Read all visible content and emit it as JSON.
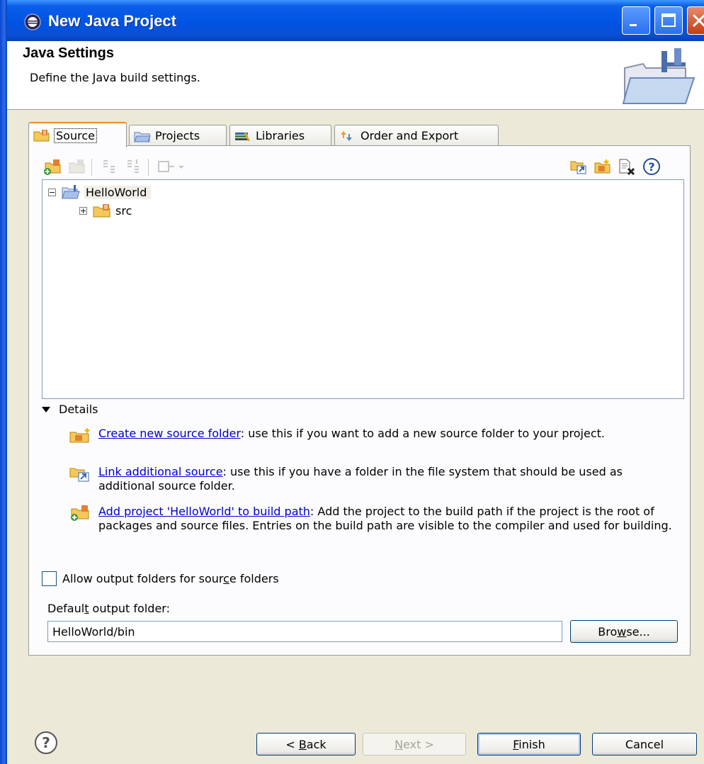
{
  "window": {
    "title": "New Java Project"
  },
  "header": {
    "title": "Java Settings",
    "description": "Define the Java build settings."
  },
  "tabs": [
    {
      "label": "Source",
      "icon": "source-folder-icon",
      "active": true
    },
    {
      "label": "Projects",
      "icon": "projects-icon",
      "active": false
    },
    {
      "label": "Libraries",
      "icon": "libraries-icon",
      "active": false
    },
    {
      "label": "Order and Export",
      "icon": "order-export-icon",
      "active": false
    }
  ],
  "toolbar": {
    "left_icons": [
      "add-folder-icon",
      "remove-folder-icon",
      "exclusion-icon",
      "inclusion-icon",
      "configure-icon"
    ],
    "right_icons": [
      "link-source-icon",
      "new-source-folder-icon",
      "clear-icon",
      "help-icon"
    ],
    "help_glyph": "?"
  },
  "tree": {
    "project": {
      "label": "HelloWorld",
      "expanded": true
    },
    "folder": {
      "label": "src",
      "expanded": false
    }
  },
  "details": {
    "toggle_label": "Details",
    "items": [
      {
        "link": "Create new source folder",
        "text": ": use this if you want to add a new source folder to your project."
      },
      {
        "link": "Link additional source",
        "text": ": use this if you have a folder in the file system that should be used as additional source folder."
      },
      {
        "link": "Add project 'HelloWorld' to build path",
        "text": ": Add the project to the build path if the project is the root of packages and source files. Entries on the build path are visible to the compiler and used for building."
      }
    ]
  },
  "options": {
    "allow_output_label_a": "Allow output folders for sour",
    "allow_output_label_u": "c",
    "allow_output_label_b": "e folders",
    "allow_output_checked": false
  },
  "output": {
    "label_a": "Defaul",
    "label_u": "t",
    "label_b": " output folder:",
    "value": "HelloWorld/bin",
    "browse_a": "Bro",
    "browse_u": "w",
    "browse_b": "se..."
  },
  "buttons": {
    "back_pre": "< ",
    "back_u": "B",
    "back_post": "ack",
    "next_u": "N",
    "next_post": "ext >",
    "finish_u": "F",
    "finish_post": "inish",
    "cancel": "Cancel"
  },
  "colors": {
    "titlebar": "#0054e3",
    "dialog_bg": "#ece9d8",
    "link": "#0000cc",
    "active_tab_accent": "#e68b2c"
  }
}
